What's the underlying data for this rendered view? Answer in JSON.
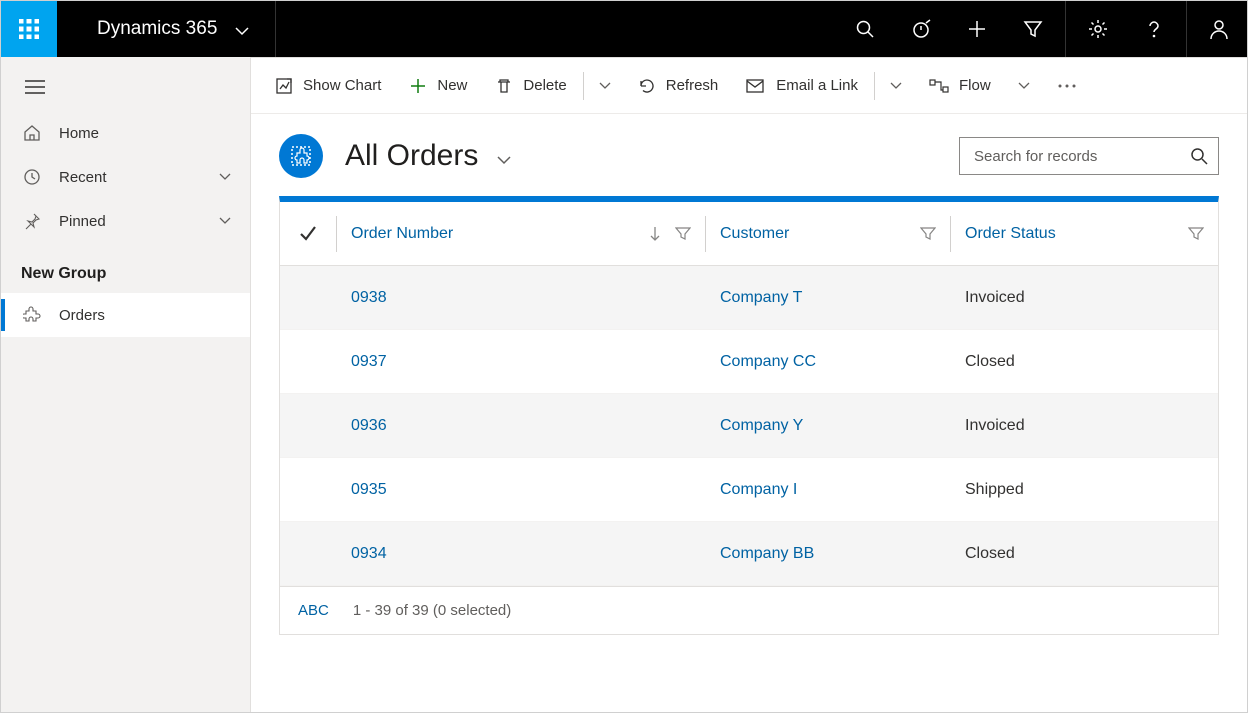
{
  "topbar": {
    "brand": "Dynamics 365"
  },
  "sidebar": {
    "home": "Home",
    "recent": "Recent",
    "pinned": "Pinned",
    "group_header": "New Group",
    "orders": "Orders"
  },
  "commandbar": {
    "show_chart": "Show Chart",
    "new": "New",
    "delete": "Delete",
    "refresh": "Refresh",
    "email_link": "Email a Link",
    "flow": "Flow"
  },
  "view": {
    "title": "All Orders",
    "search_placeholder": "Search for records"
  },
  "grid": {
    "columns": {
      "order": "Order Number",
      "customer": "Customer",
      "status": "Order Status"
    },
    "rows": [
      {
        "order": "0938",
        "customer": "Company T",
        "status": "Invoiced"
      },
      {
        "order": "0937",
        "customer": "Company CC",
        "status": "Closed"
      },
      {
        "order": "0936",
        "customer": "Company Y",
        "status": "Invoiced"
      },
      {
        "order": "0935",
        "customer": "Company I",
        "status": "Shipped"
      },
      {
        "order": "0934",
        "customer": "Company BB",
        "status": "Closed"
      }
    ],
    "footer_abc": "ABC",
    "footer_count": "1 - 39 of 39 (0 selected)"
  }
}
